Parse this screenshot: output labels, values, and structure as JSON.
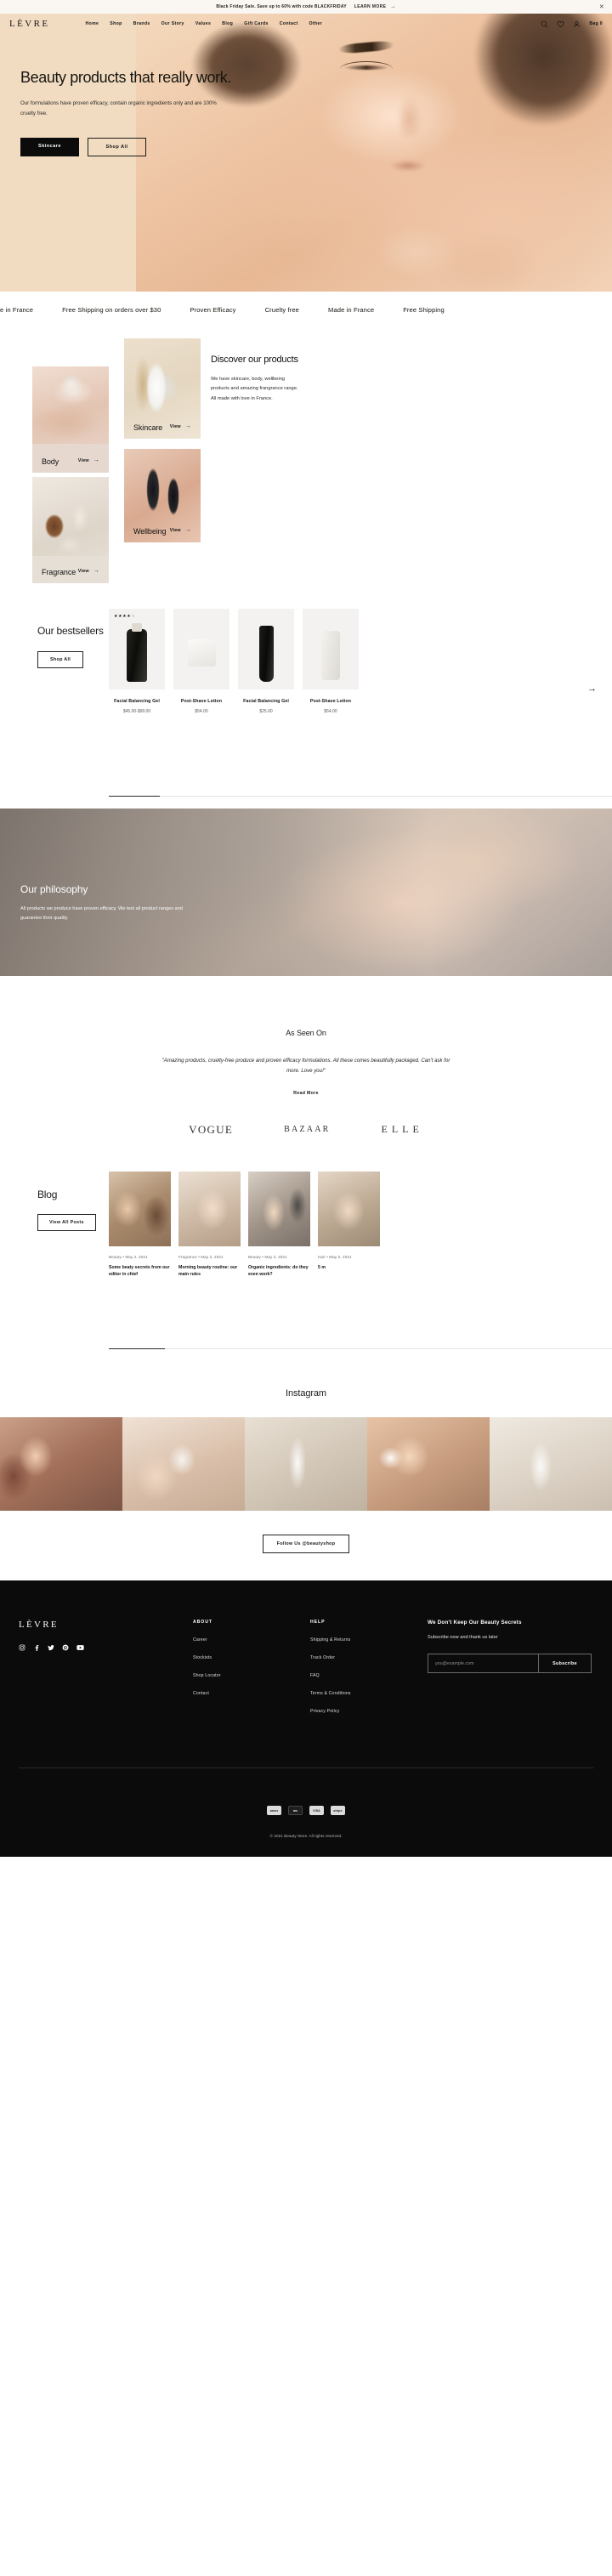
{
  "announcement": {
    "message": "Black Friday Sale. Save up to 60% with code BLACKFRIDAY",
    "cta": "LEARN MORE",
    "arrow": "→",
    "close": "✕"
  },
  "header": {
    "logo": "LÈVRE",
    "nav": [
      {
        "label": "Home"
      },
      {
        "label": "Shop"
      },
      {
        "label": "Brands"
      },
      {
        "label": "Our Story"
      },
      {
        "label": "Values"
      },
      {
        "label": "Blog"
      },
      {
        "label": "Gift Cards"
      },
      {
        "label": "Contact"
      },
      {
        "label": "Other"
      }
    ],
    "icons": [
      "search-icon",
      "wishlist-heart-icon",
      "account-icon"
    ],
    "bag_label": "Bag 0"
  },
  "hero": {
    "title": "Beauty products that really work.",
    "subtitle": "Our formulations have proven efficacy, contain organic ingredients only and are 100% cruelty free.",
    "primary_button": "Skincare",
    "secondary_button": "Shop All"
  },
  "marquee": {
    "items": [
      "e in France",
      "Free Shipping on orders over $30",
      "Proven Efficacy",
      "Cruelty free",
      "Made in France",
      "Free Shipping"
    ]
  },
  "discover": {
    "title": "Discover our products",
    "body": "We have skincare, body, wellbeing products and amazing frangrance range. All made with love in France.",
    "view_label": "View",
    "view_arrow": "→",
    "categories": [
      {
        "name": "Body"
      },
      {
        "name": "Skincare"
      },
      {
        "name": "Fragrance"
      },
      {
        "name": "Wellbeing"
      }
    ]
  },
  "bestsellers": {
    "title": "Our bestsellers",
    "shop_all": "Shop All",
    "next_arrow": "→",
    "products": [
      {
        "name": "Facial Balancing Gel",
        "price": "$45.00-$99.00",
        "rating": 4,
        "rating_max": 5
      },
      {
        "name": "Post-Shave Lotion",
        "price": "$54.00",
        "rating": 0,
        "rating_max": 5
      },
      {
        "name": "Facial Balancing Gel",
        "price": "$25.00",
        "rating": 0,
        "rating_max": 5
      },
      {
        "name": "Post-Shave Lotion",
        "price": "$54.00",
        "rating": 0,
        "rating_max": 5
      }
    ]
  },
  "philosophy": {
    "title": "Our philosophy",
    "body": "All products we produce have proven efficacy. We test all product ranges and guarantee their quality."
  },
  "as_seen_on": {
    "title": "As Seen On",
    "quote": "\"Amazing products, cruelty-free produce and proven efficacy formulations. All these comes beautifully packaged. Can't ask for more. Love you!\"",
    "read_more": "Read More",
    "logos": [
      "VOGUE",
      "BAZAAR",
      "ELLE"
    ]
  },
  "blog": {
    "title": "Blog",
    "view_all": "View All Posts",
    "posts": [
      {
        "meta": "Beauty  •  May 2, 2021",
        "title": "Some beaty secrets from our editor in chief"
      },
      {
        "meta": "Fragrance  •  May 2, 2021",
        "title": "Morning beauty routine: our main rules"
      },
      {
        "meta": "Beauty  •  May 2, 2021",
        "title": "Organic ingredients: do they even work?"
      },
      {
        "meta": "Hair  •  May 2, 2021",
        "title": "5 m"
      }
    ]
  },
  "instagram": {
    "title": "Instagram",
    "follow_button": "Follow Us @beautyshop"
  },
  "footer": {
    "logo": "LÈVRE",
    "social": [
      "instagram-icon",
      "facebook-icon",
      "twitter-icon",
      "pinterest-icon",
      "youtube-icon"
    ],
    "columns": [
      {
        "heading": "ABOUT",
        "links": [
          "Career",
          "Stockists",
          "Shop Locator",
          "Contact"
        ]
      },
      {
        "heading": "HELP",
        "links": [
          "Shipping & Returns",
          "Track Order",
          "FAQ",
          "Terms & Conditions",
          "Privacy Policy"
        ]
      }
    ],
    "newsletter": {
      "heading": "We Don't Keep Our Beauty Secrets",
      "subheading": "Subscribe now and thank us later",
      "placeholder": "you@example.com",
      "value": "",
      "button": "Subscribe"
    },
    "payments": [
      "amex",
      "mc",
      "VISA",
      "stripe"
    ],
    "copyright": "© 2021 Beauty Store. All rights reserved."
  },
  "colors": {
    "hero_bg": "#f1dcc2",
    "dark": "#0b0b0b",
    "page_bg": "#ffffff",
    "announce_bg": "#faf7f2"
  }
}
